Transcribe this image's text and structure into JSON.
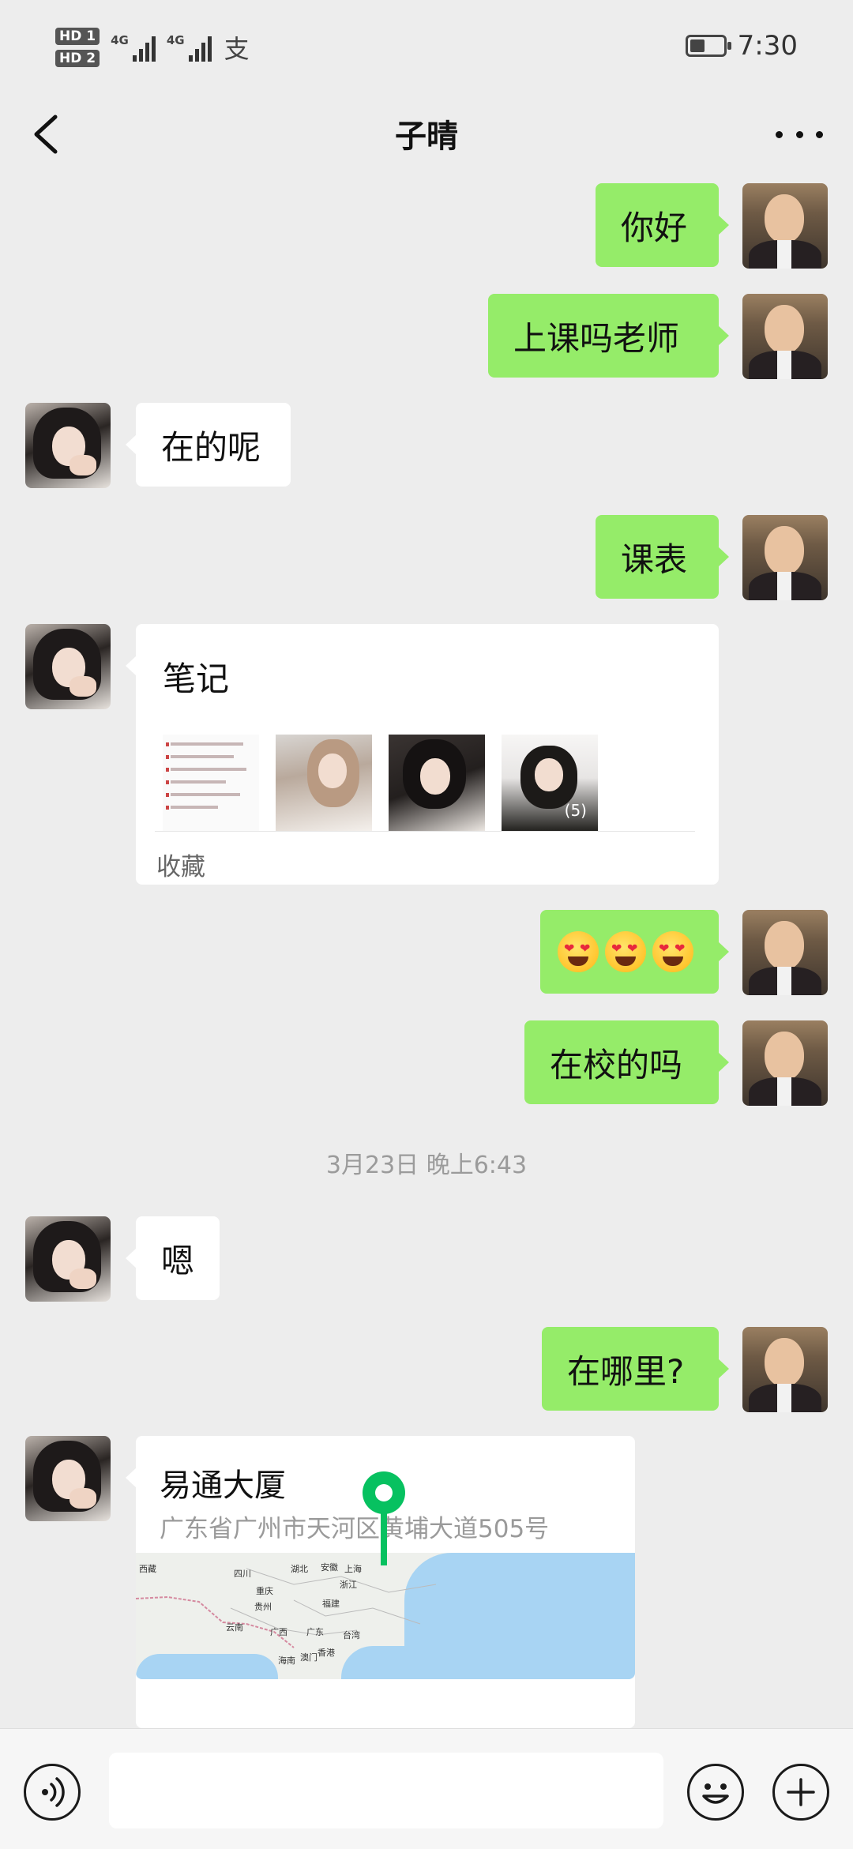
{
  "status_bar": {
    "hd1": "HD 1",
    "hd2": "HD 2",
    "net1": "4G",
    "net2": "4G",
    "time": "7:30",
    "battery_level": 0.45
  },
  "header": {
    "title": "子晴",
    "back_icon": "chevron-left-icon",
    "more_icon": "more-dots-icon"
  },
  "messages": [
    {
      "side": "right",
      "text": "你好"
    },
    {
      "side": "right",
      "text": "上课吗老师"
    },
    {
      "side": "left",
      "text": "在的呢"
    },
    {
      "side": "right",
      "text": "课表"
    },
    {
      "side": "left",
      "type": "note",
      "title": "笔记",
      "image_count": "(5)",
      "source": "收藏"
    },
    {
      "side": "right",
      "type": "emoji",
      "emoji": [
        "heart-eyes-face",
        "heart-eyes-face",
        "heart-eyes-face"
      ]
    },
    {
      "side": "right",
      "text": "在校的吗"
    },
    {
      "type": "timestamp",
      "text": "3月23日 晚上6:43"
    },
    {
      "side": "left",
      "text": "嗯"
    },
    {
      "side": "right",
      "text": "在哪里?"
    },
    {
      "side": "left",
      "type": "location",
      "name": "易通大厦",
      "address": "广东省广州市天河区黄埔大道505号",
      "map_labels": [
        "西藏",
        "四川",
        "湖北",
        "安徽",
        "上海",
        "重庆",
        "浙江",
        "贵州",
        "福建",
        "云南",
        "广西",
        "广东",
        "台湾",
        "海南",
        "澳门",
        "香港"
      ]
    }
  ],
  "input_bar": {
    "placeholder": "",
    "voice_icon": "voice-icon",
    "emoji_icon": "emoji-icon",
    "plus_icon": "plus-icon"
  },
  "colors": {
    "background": "#ededed",
    "sent_bubble": "#95ec69",
    "received_bubble": "#ffffff"
  }
}
